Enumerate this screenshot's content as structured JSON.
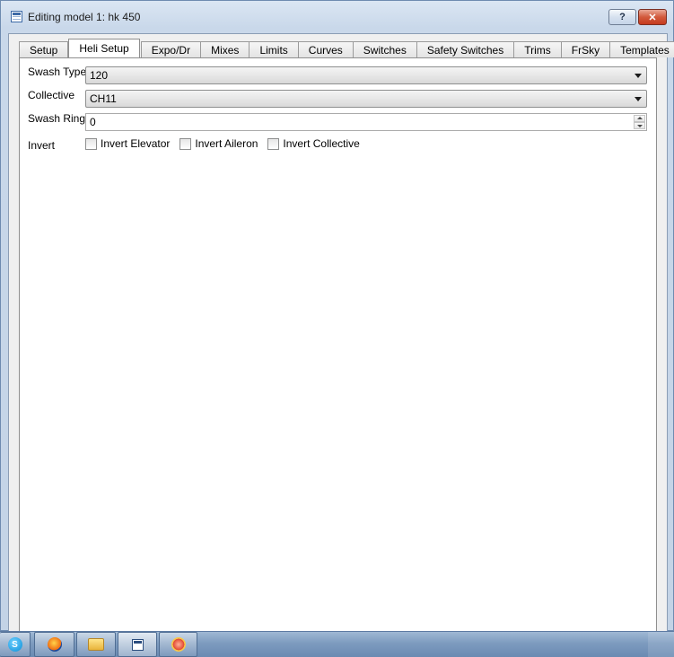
{
  "window": {
    "title": "Editing model 1: hk 450",
    "help_label": "?",
    "close_label": "✕"
  },
  "tabs": [
    {
      "label": "Setup"
    },
    {
      "label": "Heli Setup"
    },
    {
      "label": "Expo/Dr"
    },
    {
      "label": "Mixes"
    },
    {
      "label": "Limits"
    },
    {
      "label": "Curves"
    },
    {
      "label": "Switches"
    },
    {
      "label": "Safety Switches"
    },
    {
      "label": "Trims"
    },
    {
      "label": "FrSky"
    },
    {
      "label": "Templates"
    }
  ],
  "active_tab": "Heli Setup",
  "heli": {
    "swash_type": {
      "label": "Swash Type",
      "value": "120"
    },
    "collective": {
      "label": "Collective",
      "value": "CH11"
    },
    "swash_ring": {
      "label": "Swash Ring",
      "value": "0"
    },
    "invert": {
      "label": "Invert",
      "elevator": {
        "label": "Invert Elevator",
        "checked": false
      },
      "aileron": {
        "label": "Invert Aileron",
        "checked": false
      },
      "collective": {
        "label": "Invert Collective",
        "checked": false
      }
    }
  },
  "taskbar": {
    "items": [
      {
        "icon": "skype-icon",
        "glyph": "S"
      },
      {
        "icon": "firefox-icon"
      },
      {
        "icon": "folder-icon"
      },
      {
        "icon": "window-icon"
      },
      {
        "icon": "app-icon"
      }
    ]
  }
}
